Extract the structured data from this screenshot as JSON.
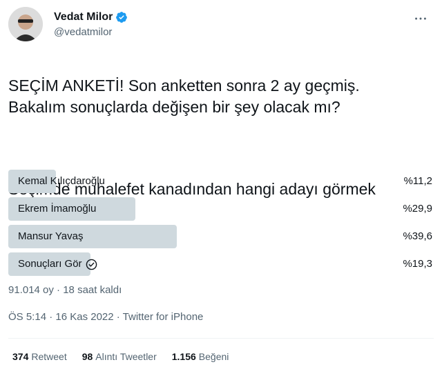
{
  "author": {
    "display_name": "Vedat Milor",
    "handle": "@vedatmilor",
    "verified": true,
    "avatar_icon": "user-avatar"
  },
  "tweet": {
    "text_line_1": "SEÇİM ANKETİ! Son anketten sonra 2 ay geçmiş.\nBakalım sonuçlarda değişen bir şey olacak mı?",
    "text_line_2": "Seçimde muhalefet kanadından hangi adayı görmek\nisterdiniz?"
  },
  "poll": {
    "options": [
      {
        "label": "Kemal Kılıçdaroğlu",
        "percent_text": "%11,2",
        "percent": 11.2
      },
      {
        "label": "Ekrem İmamoğlu",
        "percent_text": "%29,9",
        "percent": 29.9
      },
      {
        "label": "Mansur Yavaş",
        "percent_text": "%39,6",
        "percent": 39.6
      },
      {
        "label": "Sonuçları Gör",
        "percent_text": "%19,3",
        "percent": 19.3
      }
    ],
    "meta": "91.014 oy · 18 saat kaldı"
  },
  "timestamp": "ÖS 5:14 · 16 Kas 2022 · Twitter for iPhone",
  "stats": {
    "retweets_num": "374",
    "retweets_label": "Retweet",
    "quotes_num": "98",
    "quotes_label": "Alıntı Tweetler",
    "likes_num": "1.156",
    "likes_label": "Beğeni"
  },
  "colors": {
    "verified": "#1d9bf0",
    "poll_bar": "#cfd9de",
    "secondary_text": "#536471"
  }
}
